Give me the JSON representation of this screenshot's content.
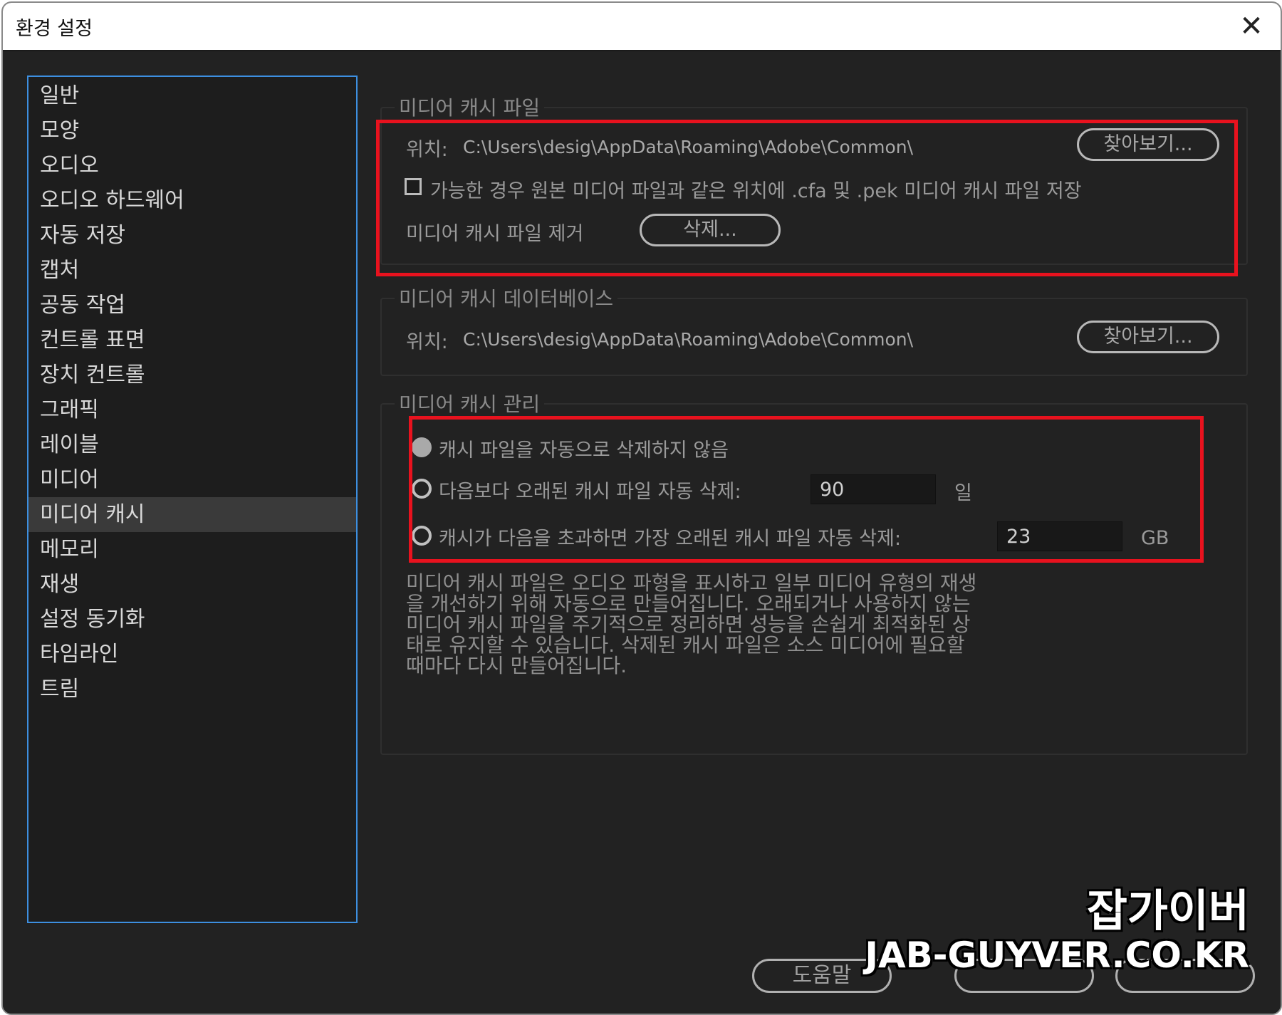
{
  "window": {
    "title": "환경 설정",
    "close_glyph": "✕"
  },
  "sidebar": {
    "items": [
      {
        "label": "일반"
      },
      {
        "label": "모양"
      },
      {
        "label": "오디오"
      },
      {
        "label": "오디오 하드웨어"
      },
      {
        "label": "자동 저장"
      },
      {
        "label": "캡처"
      },
      {
        "label": "공동 작업"
      },
      {
        "label": "컨트롤 표면"
      },
      {
        "label": "장치 컨트롤"
      },
      {
        "label": "그래픽"
      },
      {
        "label": "레이블"
      },
      {
        "label": "미디어"
      },
      {
        "label": "미디어 캐시"
      },
      {
        "label": "메모리"
      },
      {
        "label": "재생"
      },
      {
        "label": "설정 동기화"
      },
      {
        "label": "타임라인"
      },
      {
        "label": "트림"
      }
    ],
    "selected": "미디어 캐시"
  },
  "media_cache_files": {
    "title": "미디어 캐시 파일",
    "location_label": "위치:",
    "location_path": "C:\\Users\\desig\\AppData\\Roaming\\Adobe\\Common\\",
    "browse_label": "찾아보기...",
    "checkbox_label": "가능한 경우 원본 미디어 파일과 같은 위치에 .cfa 및 .pek 미디어 캐시 파일 저장",
    "checkbox_checked": false,
    "remove_label": "미디어 캐시 파일 제거",
    "delete_label": "삭제..."
  },
  "media_cache_database": {
    "title": "미디어 캐시 데이터베이스",
    "location_label": "위치:",
    "location_path": "C:\\Users\\desig\\AppData\\Roaming\\Adobe\\Common\\",
    "browse_label": "찾아보기..."
  },
  "media_cache_management": {
    "title": "미디어 캐시 관리",
    "option_never": "캐시 파일을 자동으로 삭제하지 않음",
    "option_older": "다음보다 오래된 캐시 파일 자동 삭제:",
    "older_value": "90",
    "older_unit": "일",
    "option_exceeds": "캐시가 다음을 초과하면 가장 오래된 캐시 파일 자동 삭제:",
    "exceeds_value": "23",
    "exceeds_unit": "GB",
    "selected_option": "never",
    "description_lines": [
      "미디어 캐시 파일은 오디오 파형을 표시하고 일부 미디어 유형의 재생",
      "을 개선하기 위해 자동으로 만들어집니다. 오래되거나 사용하지 않는",
      "미디어 캐시 파일을 주기적으로 정리하면 성능을 손쉽게 최적화된 상",
      "태로 유지할 수 있습니다. 삭제된 캐시 파일은 소스 미디어에 필요할",
      "때마다 다시 만들어집니다."
    ]
  },
  "footer": {
    "help_label": "도움말"
  },
  "watermark": {
    "title": "잡가이버",
    "url": "JAB-GUYVER.CO.KR"
  },
  "colors": {
    "highlight_red": "#e8121e",
    "sidebar_border": "#3d8fe0",
    "background": "#222222"
  }
}
